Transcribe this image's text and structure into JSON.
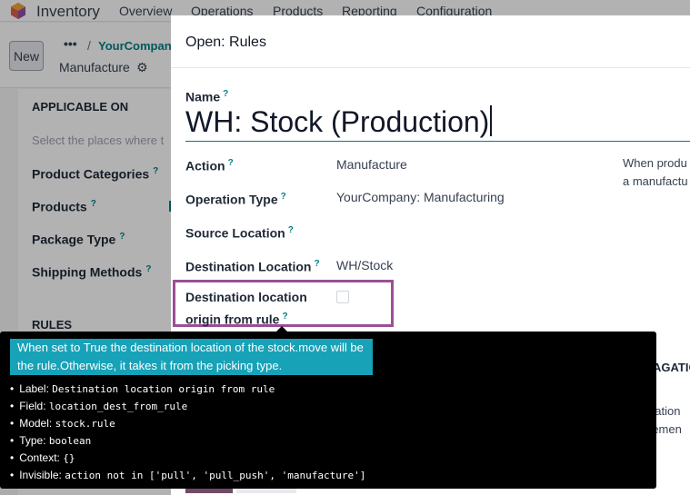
{
  "navbar": {
    "app_name": "Inventory",
    "menu": [
      "Overview",
      "Operations",
      "Products",
      "Reporting",
      "Configuration"
    ]
  },
  "control_panel": {
    "new_label": "New",
    "dots": "•••",
    "separator": "/",
    "breadcrumb_link": "YourCompany",
    "current": "Manufacture"
  },
  "background_form": {
    "section_applicable": "APPLICABLE ON",
    "help_text": "Select the places where t",
    "fields": [
      "Product Categories",
      "Products",
      "Package Type",
      "Shipping Methods"
    ],
    "section_rules": "RULES",
    "help_mark": "?"
  },
  "modal": {
    "title": "Open: Rules",
    "help_mark": "?",
    "name_label": "Name",
    "name_value": "WH: Stock (Production)",
    "fields": [
      {
        "label": "Action",
        "value": "Manufacture"
      },
      {
        "label": "Operation Type",
        "value": "YourCompany: Manufacturing"
      },
      {
        "label": "Source Location",
        "value": ""
      },
      {
        "label": "Destination Location",
        "value": "WH/Stock"
      }
    ],
    "dest_origin_line1": "Destination location",
    "dest_origin_line2": "origin from rule",
    "dest_origin_checked": false,
    "side_text_line1": "When produ",
    "side_text_line2": "a manufactu",
    "partial_heading": "AGATIO",
    "partial_text_line1": "gation",
    "partial_text_line2": "remen"
  },
  "tooltip": {
    "help_text": "When set to True the destination location of the stock.move will be the rule.Otherwise, it takes it from the picking type.",
    "details": [
      {
        "key": "Label:",
        "value": "Destination location origin from rule"
      },
      {
        "key": "Field:",
        "value": "location_dest_from_rule"
      },
      {
        "key": "Model:",
        "value": "stock.rule"
      },
      {
        "key": "Type:",
        "value": "boolean"
      },
      {
        "key": "Context:",
        "value": "{}"
      },
      {
        "key": "Invisible:",
        "value": "action not in ['pull', 'pull_push', 'manufacture']"
      }
    ]
  }
}
